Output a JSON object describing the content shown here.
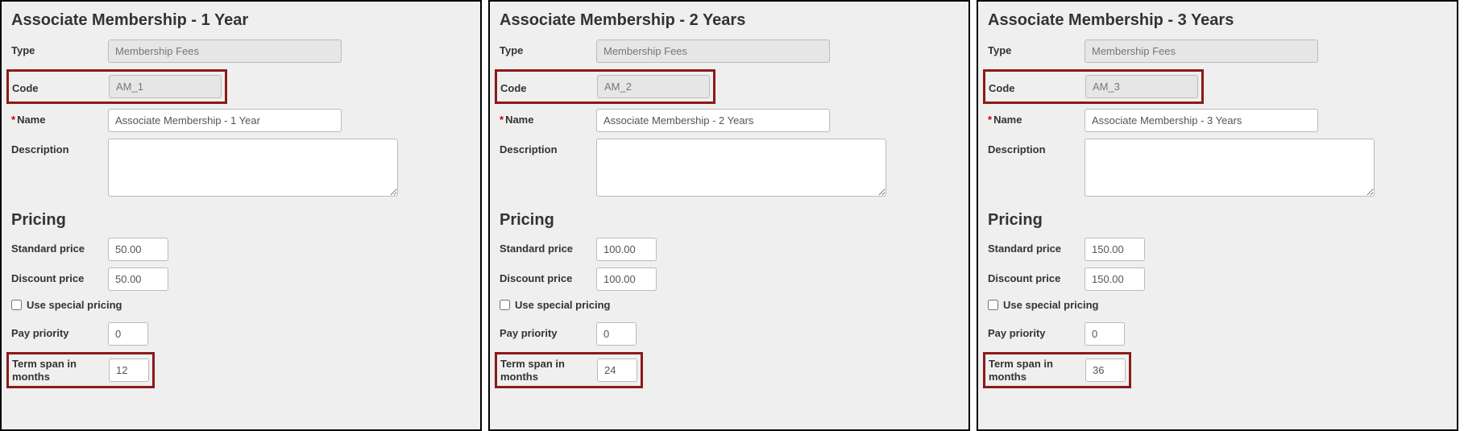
{
  "labels": {
    "type": "Type",
    "code": "Code",
    "name": "Name",
    "description": "Description",
    "pricing": "Pricing",
    "standard_price": "Standard price",
    "discount_price": "Discount price",
    "use_special_pricing": "Use special pricing",
    "pay_priority": "Pay priority",
    "term_span": "Term span in months"
  },
  "panels": [
    {
      "title": "Associate Membership - 1 Year",
      "type": "Membership Fees",
      "code": "AM_1",
      "name": "Associate Membership - 1 Year",
      "description": "",
      "standard_price": "50.00",
      "discount_price": "50.00",
      "use_special_pricing": false,
      "pay_priority": "0",
      "term_span": "12"
    },
    {
      "title": "Associate Membership - 2 Years",
      "type": "Membership Fees",
      "code": "AM_2",
      "name": "Associate Membership - 2 Years",
      "description": "",
      "standard_price": "100.00",
      "discount_price": "100.00",
      "use_special_pricing": false,
      "pay_priority": "0",
      "term_span": "24"
    },
    {
      "title": "Associate Membership - 3 Years",
      "type": "Membership Fees",
      "code": "AM_3",
      "name": "Associate Membership - 3 Years",
      "description": "",
      "standard_price": "150.00",
      "discount_price": "150.00",
      "use_special_pricing": false,
      "pay_priority": "0",
      "term_span": "36"
    }
  ]
}
